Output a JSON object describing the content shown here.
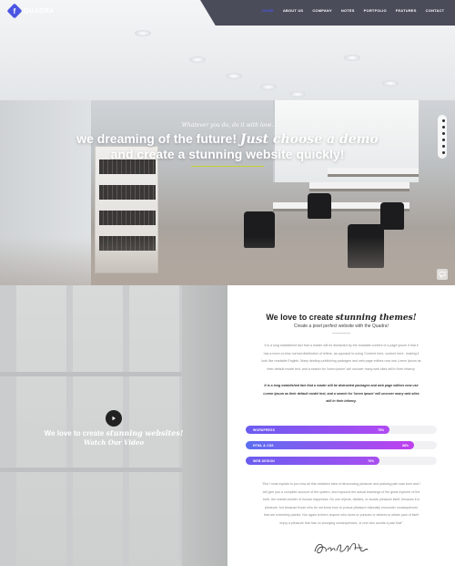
{
  "brand": {
    "logo_letter": "f",
    "name": "QUADRA",
    "accent_color": "#4a56e2"
  },
  "nav": {
    "items": [
      {
        "label": "HOME",
        "active": true
      },
      {
        "label": "ABOUT US",
        "active": false
      },
      {
        "label": "COMPANY",
        "active": false
      },
      {
        "label": "NOTES",
        "active": false
      },
      {
        "label": "PORTFOLIO",
        "active": false
      },
      {
        "label": "FEATURES",
        "active": false
      },
      {
        "label": "CONTACT",
        "active": false
      }
    ]
  },
  "hero": {
    "kicker": "Whatever you do, do it with love.",
    "line1_main": "we dreaming of the future! ",
    "line1_accent": "Just choose a demo",
    "line2": "and create a stunning website quickly!",
    "underline_color": "#c7d22c",
    "dots_count": 6
  },
  "video": {
    "title_main": "We love to create ",
    "title_accent": "stunning websites!",
    "subtitle": "Watch Our Video"
  },
  "about": {
    "title_main": "We love to create ",
    "title_accent": "stunning themes!",
    "subtitle": "Create a pixel perfect website with the Quadra!",
    "para1_lines": [
      "It is a long established fact that a reader will be distracted by the readable content of a page ipsum it that it",
      "has a more-or-less normal distribution of letters, as opposed to using 'Content here, content here', making it",
      "look like readable English. Many desktop publishing packages and web page editors now use Lorem Ipsum as",
      "their default model text, and a search for 'lorem ipsum' will uncover many web sites still in their infancy."
    ],
    "para2_lines": [
      "It is a long established fact that a reader will be distracted packages and web page editors now use",
      "Lorem Ipsum as their default model text, and a search for 'lorem ipsum' will uncover many web sites",
      "still in their infancy."
    ],
    "skills": [
      {
        "label": "WORDPRESS",
        "percent": 75,
        "color_from": "#6a5cf0",
        "color_to": "#b14af2"
      },
      {
        "label": "HTML & CSS",
        "percent": 88,
        "color_from": "#5b6ef0",
        "color_to": "#c040ee"
      },
      {
        "label": "WEB DESIGN",
        "percent": 70,
        "color_from": "#6a5cf0",
        "color_to": "#a84ff0"
      }
    ],
    "para3_lines": [
      "\"But I must explain to you how all this mistaken idea of denouncing pleasure and praising pain was born and I",
      "will give you a complete account of the system, and expound the actual teachings of the great explorer of the",
      "truth, the master-builder of human happiness. No one rejects, dislikes, or avoids pleasure itself, because it is",
      "pleasure, but because those who do not know how to pursue pleasure rationally encounter consequences",
      "that are extremely painful. Nor again is there anyone who loves or pursues or desires to obtain pain of itself",
      "enjoy a pleasure that has no annoying consequences, or one who avoids a pain that\""
    ]
  }
}
